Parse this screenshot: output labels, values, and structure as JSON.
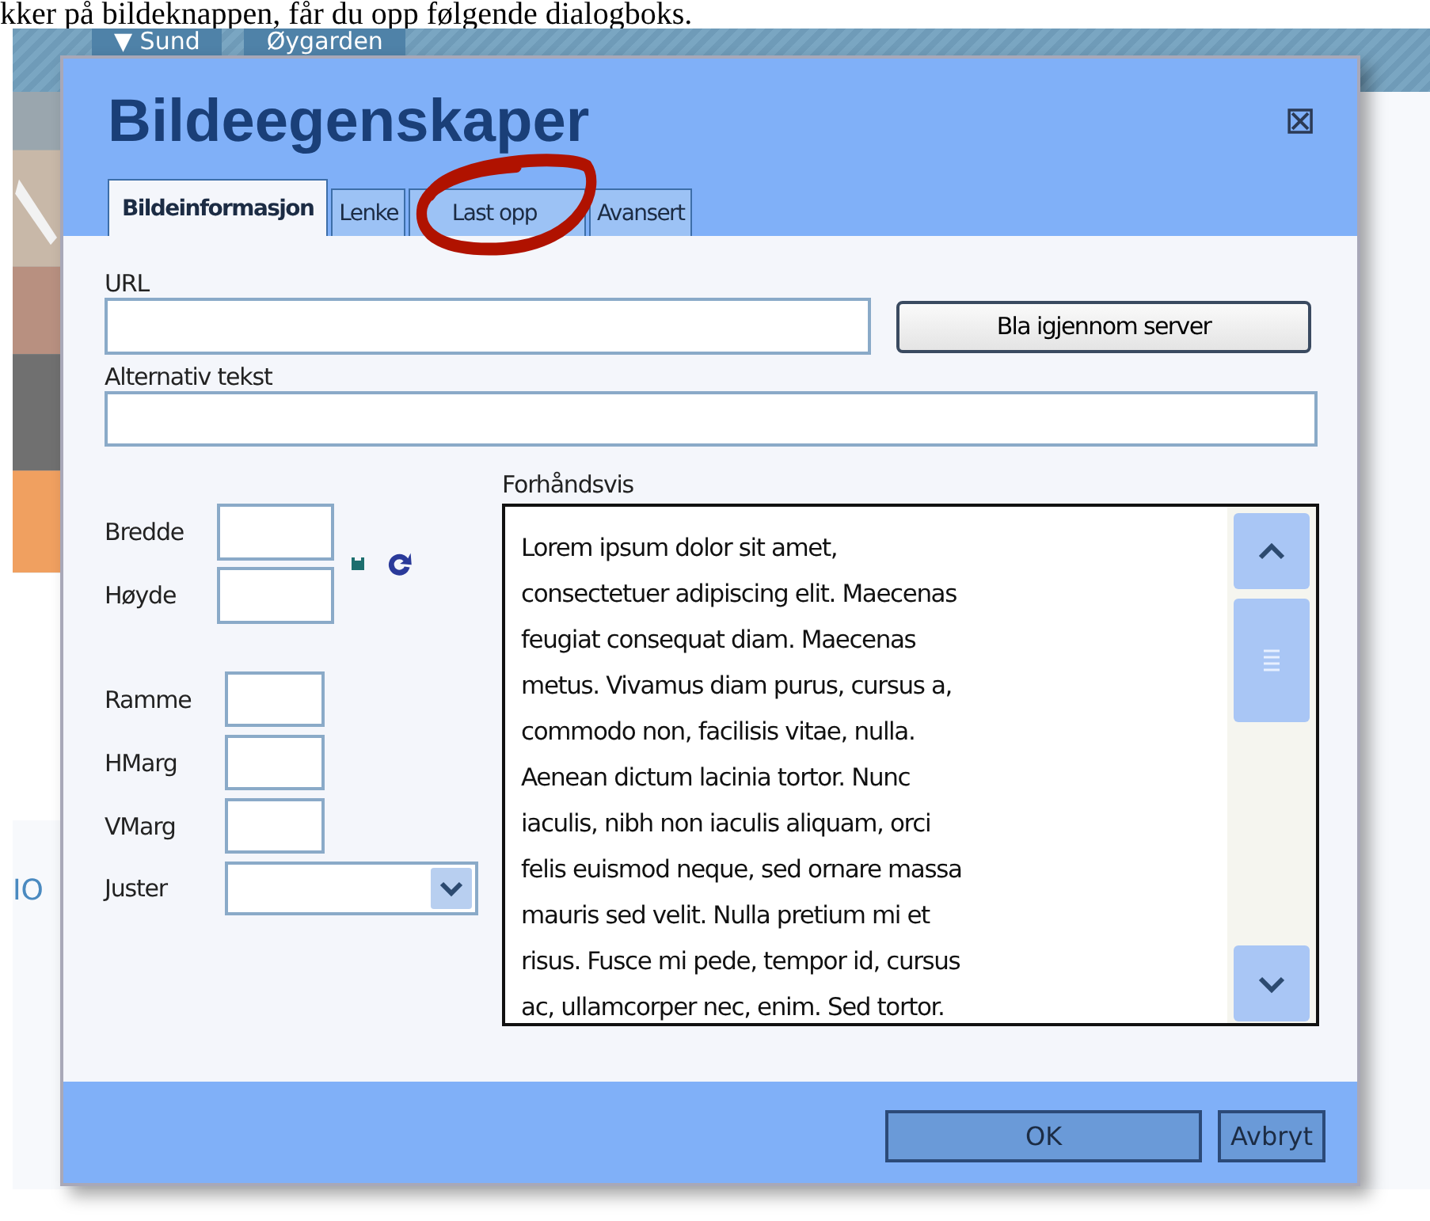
{
  "document_text": "kker på bildeknappen, får du opp følgende dialogboks.",
  "background_page": {
    "nav_tabs": [
      "▼ Sund",
      "Øygarden"
    ],
    "fragment": "IO"
  },
  "dialog": {
    "title": "Bildeegenskaper",
    "close_icon": "⊠",
    "tabs": [
      {
        "label": "Bildeinformasjon",
        "selected": true
      },
      {
        "label": "Lenke",
        "selected": false
      },
      {
        "label": "Last opp",
        "selected": false
      },
      {
        "label": "Avansert",
        "selected": false
      }
    ],
    "url": {
      "label": "URL"
    },
    "browse_button": "Bla igjennom server",
    "alt_text": {
      "label": "Alternativ tekst"
    },
    "size_fields": [
      {
        "label": "Bredde"
      },
      {
        "label": "Høyde"
      }
    ],
    "spacing_fields": [
      {
        "label": "Ramme"
      },
      {
        "label": "HMarg"
      },
      {
        "label": "VMarg"
      }
    ],
    "align_field": {
      "label": "Juster"
    },
    "preview": {
      "label": "Forhåndsvis",
      "lines": [
        "Lorem ipsum dolor sit amet,",
        "consectetuer adipiscing elit. Maecenas",
        "feugiat consequat diam. Maecenas",
        "metus. Vivamus diam purus, cursus a,",
        "commodo non, facilisis vitae, nulla.",
        "Aenean dictum lacinia tortor. Nunc",
        "iaculis, nibh non iaculis aliquam, orci",
        "felis euismod neque, sed ornare massa",
        "mauris sed velit. Nulla pretium mi et",
        "risus. Fusce mi pede, tempor id, cursus",
        "ac, ullamcorper nec, enim. Sed tortor."
      ]
    },
    "buttons": [
      "OK",
      "Avbryt"
    ]
  },
  "annotation": {
    "kind": "circle",
    "color": "#b01200"
  }
}
